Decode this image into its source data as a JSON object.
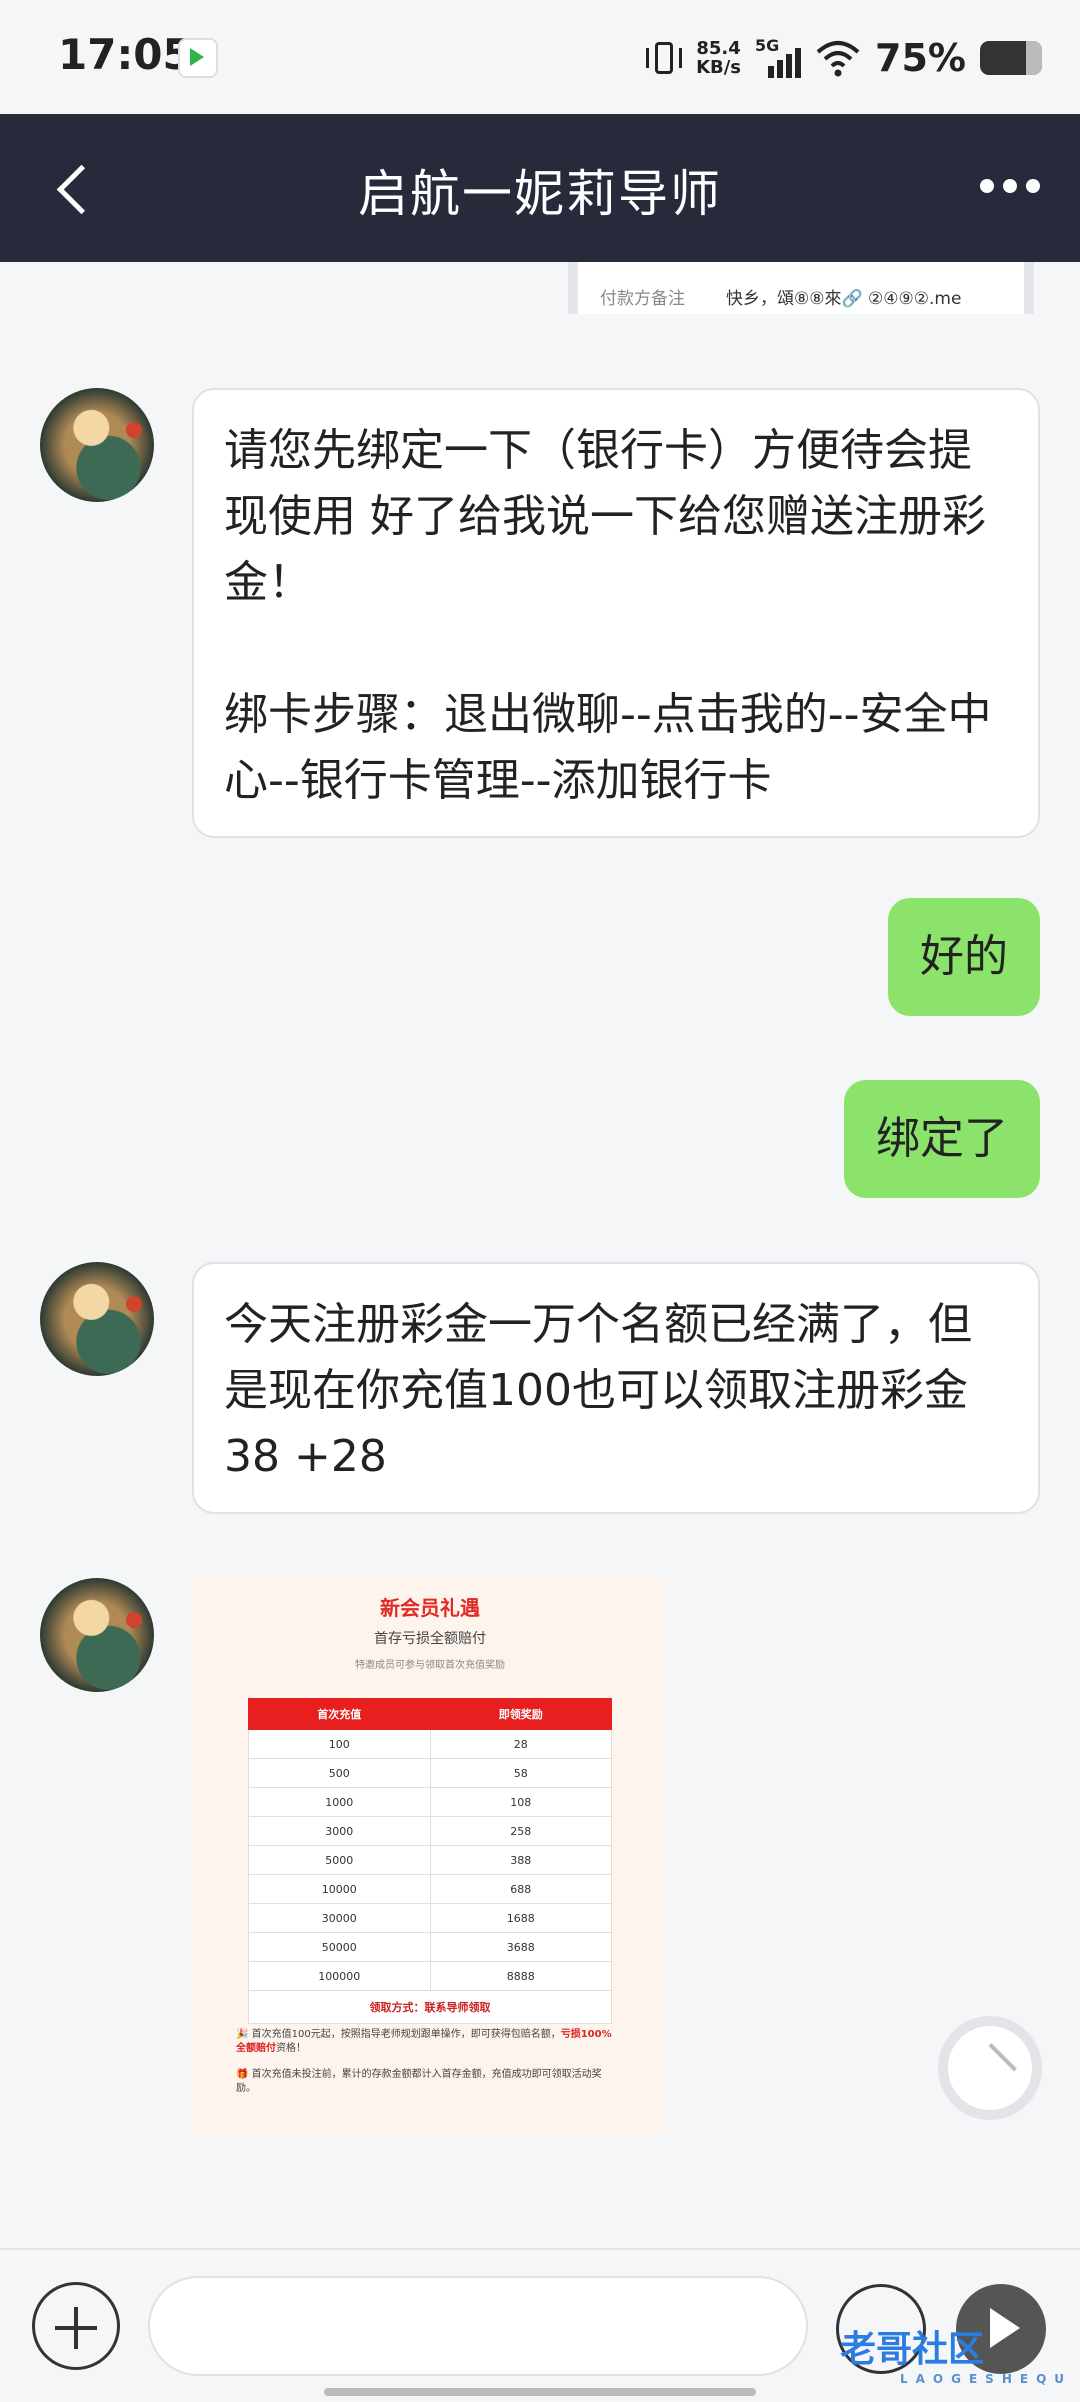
{
  "status_bar": {
    "time": "17:05",
    "net_speed_value": "85.4",
    "net_speed_unit": "KB/s",
    "signal_label": "5G",
    "battery": "75%"
  },
  "header": {
    "title": "启航一妮莉导师"
  },
  "receipt": {
    "label": "付款方备注",
    "value": "快乡，頌⑧⑧來🔗 ②④⑨②.me"
  },
  "messages": [
    {
      "from": "agent",
      "text": "请您先绑定一下（银行卡）方便待会提现使用 好了给我说一下给您赠送注册彩金！\n\n绑卡步骤：退出微聊--点击我的--安全中心--银行卡管理--添加银行卡"
    },
    {
      "from": "me",
      "text": "好的"
    },
    {
      "from": "me",
      "text": "绑定了"
    },
    {
      "from": "agent",
      "text": "今天注册彩金一万个名额已经满了，但是现在你充值100也可以领取注册彩金38 +28"
    }
  ],
  "promo_image": {
    "title": "新会员礼遇",
    "subtitle": "首存亏损全额赔付",
    "note": "特邀成员可参与领取首次充值奖励",
    "headers": [
      "首次充值",
      "即领奖励"
    ],
    "rows": [
      [
        "100",
        "28"
      ],
      [
        "500",
        "58"
      ],
      [
        "1000",
        "108"
      ],
      [
        "3000",
        "258"
      ],
      [
        "5000",
        "388"
      ],
      [
        "10000",
        "688"
      ],
      [
        "30000",
        "1688"
      ],
      [
        "50000",
        "3688"
      ],
      [
        "100000",
        "8888"
      ]
    ],
    "contact": "领取方式：联系导师领取",
    "footnote1": "🎉 首次充值100元起，按照指导老师规划跟单操作，即可获得包赔名额，",
    "footnote1_red": "亏损100%全额赔付",
    "footnote1_end": "资格！",
    "footnote2": "🎁 首次充值未投注前，累计的存款金额都计入首存金额，充值成功即可领取活动奖励。"
  },
  "watermark": {
    "text": "老哥社区",
    "sub": "LAOGESHEQU"
  }
}
